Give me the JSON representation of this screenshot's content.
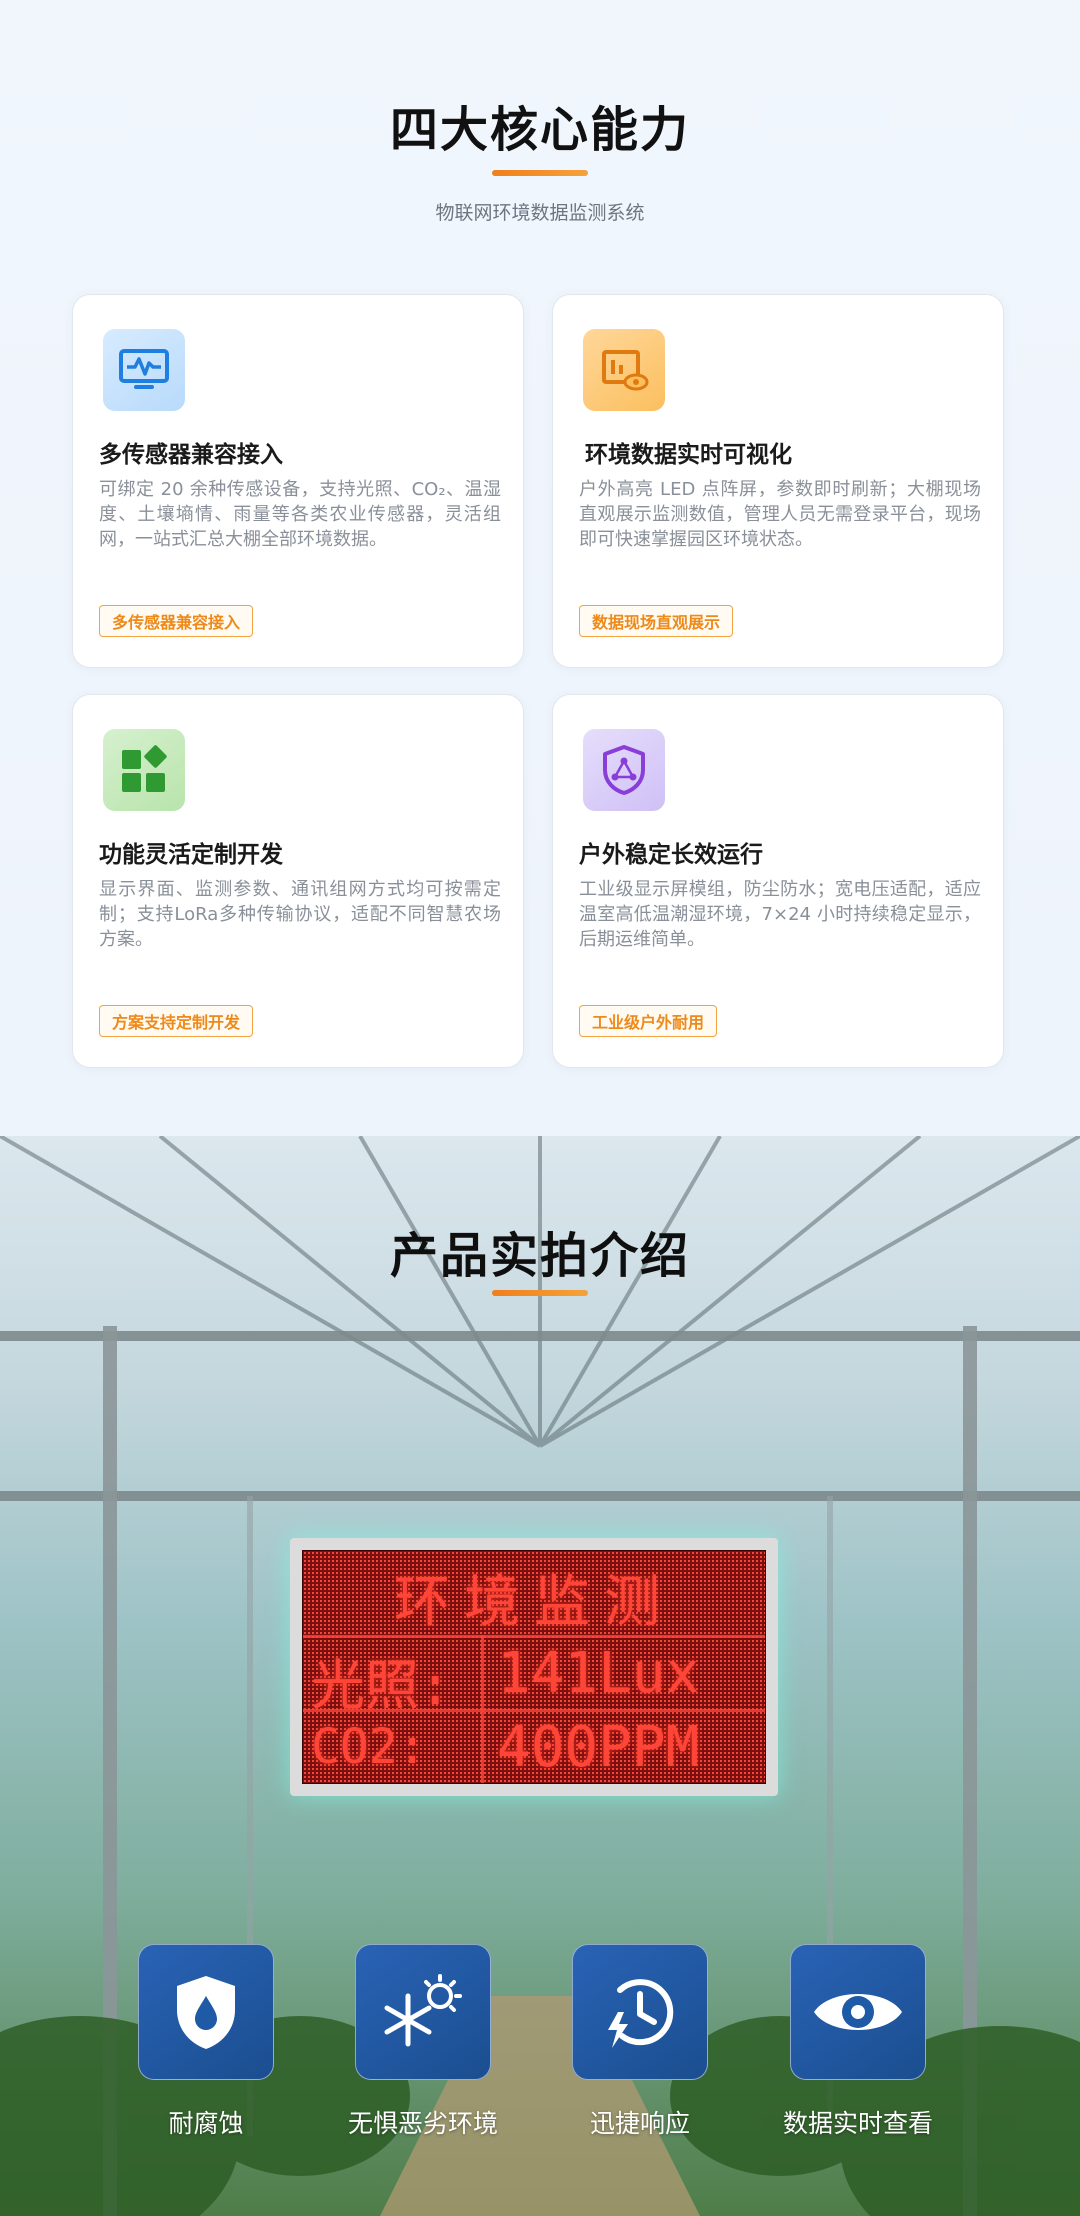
{
  "capabilities": {
    "title": "四大核心能力",
    "subtitle": "物联网环境数据监测系统",
    "cards": [
      {
        "icon": "monitor-pulse-icon",
        "title": "多传感器兼容接入",
        "desc": "可绑定 20 余种传感设备，支持光照、CO₂、温湿度、土壤墒情、雨量等各类农业传感器，灵活组网，一站式汇总大棚全部环境数据。",
        "tag": "多传感器兼容接入"
      },
      {
        "icon": "chart-eye-icon",
        "title": "环境数据实时可视化",
        "desc": "户外高亮 LED 点阵屏，参数即时刷新；大棚现场直观展示监测数值，管理人员无需登录平台，现场即可快速掌握园区环境状态。",
        "tag": "数据现场直观展示"
      },
      {
        "icon": "grid-blocks-icon",
        "title": "功能灵活定制开发",
        "desc": "显示界面、监测参数、通讯组网方式均可按需定制；支持LoRa多种传输协议，适配不同智慧农场方案。",
        "tag": "方案支持定制开发"
      },
      {
        "icon": "shield-network-icon",
        "title": "户外稳定长效运行",
        "desc": "工业级显示屏模组，防尘防水；宽电压适配，适应温室高低温潮湿环境，7×24 小时持续稳定显示，后期运维简单。",
        "tag": "工业级户外耐用"
      }
    ]
  },
  "product": {
    "title": "产品实拍介绍",
    "led": {
      "line1": "环境监测",
      "label2": "光照:",
      "value2": "141Lux",
      "label3": "CO2:",
      "value3": "400PPM"
    },
    "features": [
      {
        "icon": "shield-drop-icon",
        "label": "耐腐蚀"
      },
      {
        "icon": "snow-sun-icon",
        "label": "无惧恶劣环境"
      },
      {
        "icon": "clock-bolt-icon",
        "label": "迅捷响应"
      },
      {
        "icon": "eye-icon",
        "label": "数据实时查看"
      }
    ]
  }
}
